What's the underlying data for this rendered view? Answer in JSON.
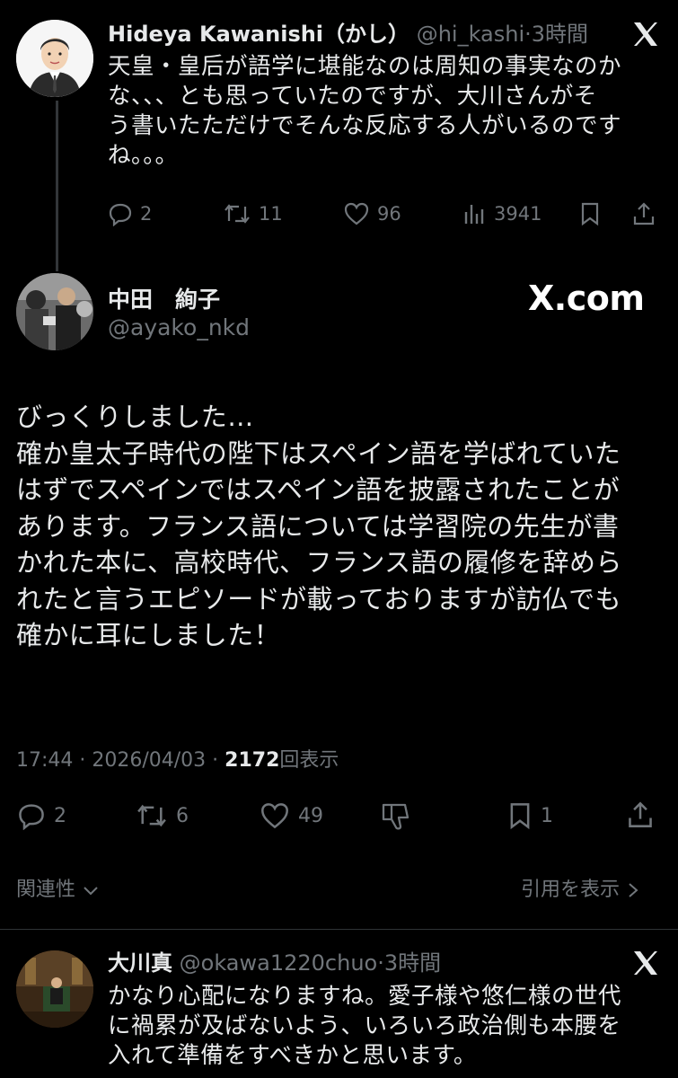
{
  "tweet1": {
    "name": "Hideya Kawanishi（かし）",
    "handle": "@hi_kashi",
    "sep": "·",
    "time": "3時間",
    "lines": [
      "天皇・皇后が語学に堪能なのは周知の事実なのか",
      "な、、、とも思っていたのですが、大川さんがそ",
      "う書いたただけでそんな反応する人がいるのです",
      "ね。。。"
    ],
    "replies": "2",
    "reposts": "11",
    "likes": "96",
    "views": "3941"
  },
  "main": {
    "name": "中田　絢子",
    "handle": "@ayako_nkd",
    "watermark": "X.com",
    "lines": [
      "びっくりしました…",
      "確か皇太子時代の陛下はスペイン語を学ばれていた",
      "はずでスペインではスペイン語を披露されたことが",
      "あります。フランス語については学習院の先生が書",
      "かれた本に、高校時代、フランス語の履修を辞めら",
      "れたと言うエピソードが載っておりますが訪仏でも",
      "確かに耳にしました！"
    ],
    "timestamp": "17:44 · 2026/04/03 ·",
    "view_count": "2172",
    "view_label": "回表示",
    "replies": "2",
    "reposts": "6",
    "likes": "49",
    "bookmarks": "1"
  },
  "footer": {
    "related": "関連性",
    "quotes": "引用を表示"
  },
  "tweet3": {
    "name": "大川真",
    "handle": "@okawa1220chuo",
    "sep": "·",
    "time": "3時間",
    "lines": [
      "かなり心配になりますね。愛子様や悠仁様の世代",
      "に禍累が及ばないよう、いろいろ政治側も本腰を",
      "入れて準備をすべきかと思います。"
    ]
  },
  "icons": [
    "x-logo-icon",
    "reply-icon",
    "repost-icon",
    "like-icon",
    "views-icon",
    "bookmark-icon",
    "share-icon",
    "dislike-icon",
    "chevron-down-icon",
    "chevron-right-icon"
  ]
}
